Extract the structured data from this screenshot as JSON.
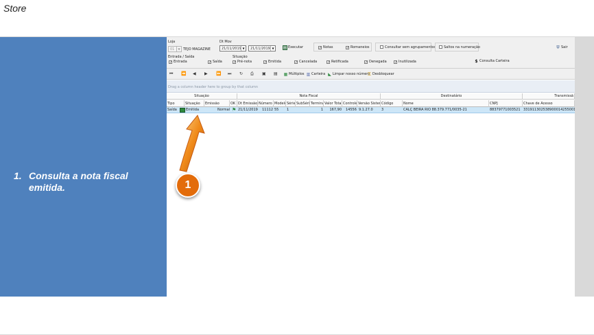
{
  "page": {
    "header": "Store"
  },
  "step": {
    "number": "1.",
    "text": "Consulta a nota fiscal emitida."
  },
  "callout": "1",
  "filters": {
    "loja_label": "Loja",
    "loja_code": "01",
    "loja_name": "TEJO MAGAZINE",
    "dtmov_label": "Dt Mov",
    "date_from": "21/11/2019",
    "date_to": "21/11/2019",
    "executar": "Executar",
    "notas": "Notas",
    "romaneios": "Romaneios",
    "sem_agrupamentos": "Consultar sem agrupamentos",
    "saltos": "Saltos na numeração",
    "sair": "Sair",
    "entrada_saida_label": "Entrada / Saída",
    "entrada": "Entrada",
    "saida": "Saída",
    "situacao_label": "Situação",
    "pre_nota": "Pré-nota",
    "emitida": "Emitida",
    "cancelada": "Cancelada",
    "retificada": "Retificada",
    "denegada": "Denegada",
    "inutilizada": "Inutilizada",
    "consulta_carteira": "Consulta Carteira"
  },
  "toolbar": {
    "multiplos": "Múltiplos",
    "carteira": "Carteira",
    "limpar": "Limpar nosso número",
    "desbloquear": "Desbloquear"
  },
  "group_panel": "Drag a column header here to group by that column",
  "grid": {
    "bands": {
      "situacao": "Situação",
      "nota_fiscal": "Nota Fiscal",
      "destinatario": "Destinatário",
      "transmissao": "Transmissã"
    },
    "columns": {
      "tipo": "Tipo",
      "situacao": "Situação",
      "emissao": "Emissão",
      "ok": "OK",
      "dt_emissao": "Dt Emissão",
      "numero": "Número",
      "modelo": "Modelo",
      "serie": "Série",
      "subserie": "SubSérie",
      "terminal": "Terminal",
      "valor_total": "Valor Total",
      "controle": "Controle",
      "versao": "Versão Sistema",
      "codigo": "Código",
      "nome": "Nome",
      "cnpj": "CNPJ",
      "chave": "Chave de Acesso"
    },
    "row": {
      "tipo": "Saída",
      "situacao": "Emitida",
      "emissao": "Normal",
      "dt_emissao": "21/11/2019",
      "numero": "11112",
      "modelo": "55",
      "serie": "1",
      "terminal": "1",
      "valor_total": "167,90",
      "controle": "14556",
      "versao": "9.1.27.0",
      "codigo": "3",
      "nome": "CALÇ BEIRA RIO 88.379.771/0035-21",
      "cnpj": "88379771003521",
      "chave": "33191130253890001425500100"
    }
  },
  "colors": {
    "panel": "#4f81bd",
    "callout": "#e36c0a",
    "selected_row": "#cde6f7"
  }
}
